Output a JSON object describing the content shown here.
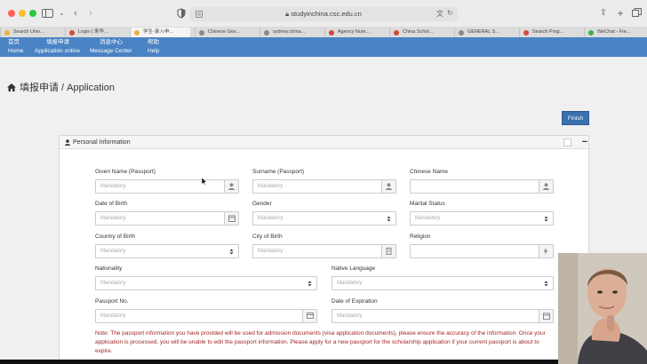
{
  "browser": {
    "url": "studyinchina.csc.edu.cn",
    "tabs": [
      {
        "label": "Search Univ...",
        "color": "#e8b33f"
      },
      {
        "label": "Login | 来华...",
        "color": "#d14a3b"
      },
      {
        "label": "学生-录入申...",
        "color": "#e8b33f"
      },
      {
        "label": "Chinese Gov...",
        "color": "#888888"
      },
      {
        "label": "sydney.china...",
        "color": "#888888"
      },
      {
        "label": "Agency Num...",
        "color": "#d14a3b"
      },
      {
        "label": "China Schol...",
        "color": "#d14a3b"
      },
      {
        "label": "GENERAL S...",
        "color": "#888888"
      },
      {
        "label": "Search Prog...",
        "color": "#d14a3b"
      },
      {
        "label": "WeChat - Fre...",
        "color": "#3bb14a"
      }
    ]
  },
  "nav": [
    {
      "zh": "首页",
      "en": "Home"
    },
    {
      "zh": "填报申请",
      "en": "Application online"
    },
    {
      "zh": "消息中心",
      "en": "Message Center"
    },
    {
      "zh": "帮助",
      "en": "Help"
    }
  ],
  "page": {
    "title": "填报申请 / Application",
    "finish_label": "Finish",
    "panel_title": "Personal Information"
  },
  "form": {
    "placeholder": "Mandatory",
    "given_name": "Given Name (Passport)",
    "surname": "Surname (Passport)",
    "chinese_name": "Chinese Name",
    "dob": "Date of Birth",
    "gender": "Gender",
    "marital": "Marital Status",
    "country_birth": "Country of Birth",
    "city_birth": "City of Birth",
    "religion": "Religion",
    "nationality": "Nationality",
    "native_language": "Native Language",
    "passport_no": "Passport No.",
    "expiration": "Date of Expiration",
    "note": "Note: The passport information you have provided will be used for admission documents (visa application documents), please ensure the accuracy of the information. Once your application is processed, you will be unable to edit the passport information. Please apply for a new passport for the scholarship application if your current passport is about to expire."
  },
  "colors": {
    "nav_bg": "#4a83c4",
    "finish_bg": "#3a6fb0",
    "note_text": "#a22525"
  }
}
